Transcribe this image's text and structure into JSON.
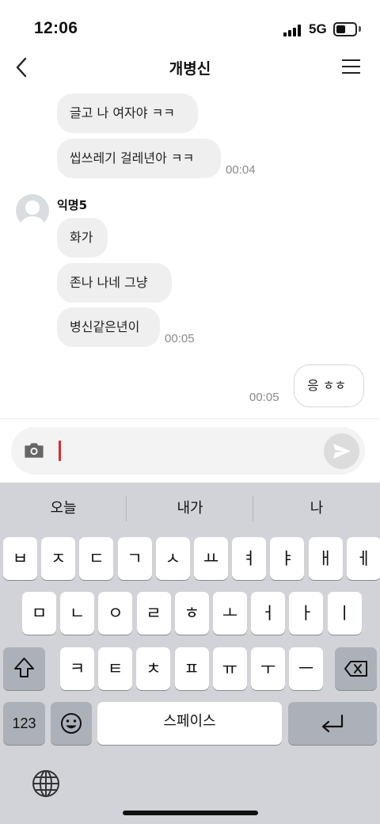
{
  "status": {
    "time": "12:06",
    "network": "5G"
  },
  "header": {
    "title": "개병신"
  },
  "messages": [
    {
      "text": "글고 나 여자야 ㅋㅋ"
    },
    {
      "text": "씹쓰레기 걸레년아 ㅋㅋ",
      "time": "00:04"
    },
    {
      "sender": "익명5"
    },
    {
      "text": "화가"
    },
    {
      "text": "존나  나네 그냥"
    },
    {
      "text": "병신같은년이",
      "time": "00:05"
    },
    {
      "text": "응 ㅎㅎ",
      "time": "00:05",
      "mine": true
    }
  ],
  "input": {
    "value": ""
  },
  "keyboard": {
    "suggestions": [
      "오늘",
      "내가",
      "나"
    ],
    "row1": [
      "ㅂ",
      "ㅈ",
      "ㄷ",
      "ㄱ",
      "ㅅ",
      "ㅛ",
      "ㅕ",
      "ㅑ",
      "ㅐ",
      "ㅔ"
    ],
    "row2": [
      "ㅁ",
      "ㄴ",
      "ㅇ",
      "ㄹ",
      "ㅎ",
      "ㅗ",
      "ㅓ",
      "ㅏ",
      "ㅣ"
    ],
    "row3": [
      "ㅋ",
      "ㅌ",
      "ㅊ",
      "ㅍ",
      "ㅠ",
      "ㅜ",
      "ㅡ"
    ],
    "numbers_label": "123",
    "space_label": "스페이스"
  },
  "colors": {
    "caret": "#e02a2a",
    "bubble": "#efefef",
    "keyboard_bg": "#d1d3d9"
  },
  "icons": [
    "back-arrow-icon",
    "hamburger-menu-icon",
    "camera-icon",
    "send-icon",
    "shift-icon",
    "delete-icon",
    "emoji-icon",
    "return-icon",
    "globe-icon"
  ]
}
